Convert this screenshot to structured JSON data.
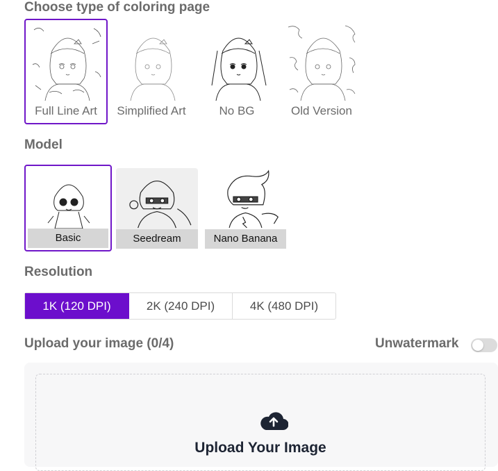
{
  "coloring_type": {
    "title": "Choose type of coloring page",
    "options": [
      {
        "label": "Full Line Art",
        "selected": true
      },
      {
        "label": "Simplified Art",
        "selected": false
      },
      {
        "label": "No BG",
        "selected": false
      },
      {
        "label": "Old Version",
        "selected": false
      }
    ]
  },
  "model": {
    "title": "Model",
    "options": [
      {
        "label": "Basic",
        "selected": true
      },
      {
        "label": "Seedream",
        "selected": false
      },
      {
        "label": "Nano Banana",
        "selected": false
      }
    ]
  },
  "resolution": {
    "title": "Resolution",
    "options": [
      {
        "label": "1K (120 DPI)",
        "selected": true
      },
      {
        "label": "2K (240 DPI)",
        "selected": false
      },
      {
        "label": "4K (480 DPI)",
        "selected": false
      }
    ]
  },
  "upload": {
    "title": "Upload your image (0/4)",
    "unwatermark_label": "Unwatermark",
    "unwatermark_enabled": false,
    "drop_title": "Upload Your Image",
    "icon": "cloud-upload-icon"
  },
  "colors": {
    "accent": "#6c0ecc",
    "selected_border": "#6f16c8",
    "heading": "#6b6b6b",
    "model_label_bg": "#d6d6d6"
  }
}
